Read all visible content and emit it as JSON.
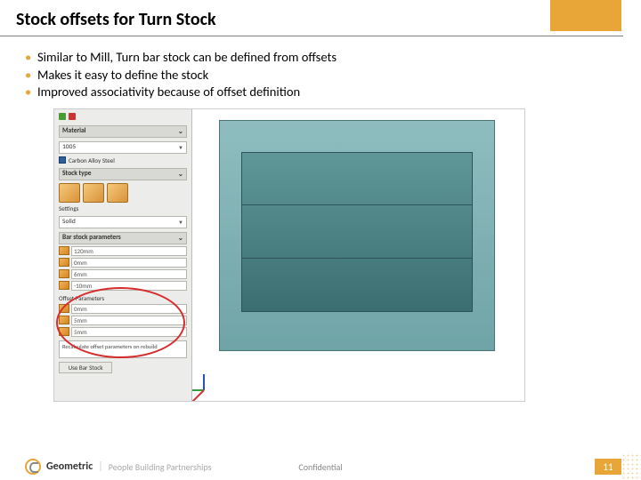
{
  "title": "Stock offsets for Turn Stock",
  "bullets": [
    "Similar to Mill, Turn bar stock can be defined from offsets",
    "Makes it easy to define the stock",
    "Improved associativity because of offset definition"
  ],
  "panel": {
    "material_h": "Material",
    "material_val": "1005",
    "material_legend": "Carbon Alloy Steel",
    "stocktype_h": "Stock type",
    "settings_l": "Settings",
    "settings_val": "Solid",
    "bar_params_h": "Bar stock parameters",
    "fields": [
      "120mm",
      "0mm",
      "6mm",
      "-10mm"
    ],
    "offset_h": "Offset Parameters",
    "offset_fields": [
      "0mm",
      "5mm",
      "5mm"
    ],
    "note": "Recalculate offset parameters on rebuild",
    "use_btn": "Use Bar Stock"
  },
  "footer": {
    "brand_bold": "Geometric",
    "tagline": "People Building Partnerships",
    "confidential": "Confidential",
    "page": "11"
  }
}
